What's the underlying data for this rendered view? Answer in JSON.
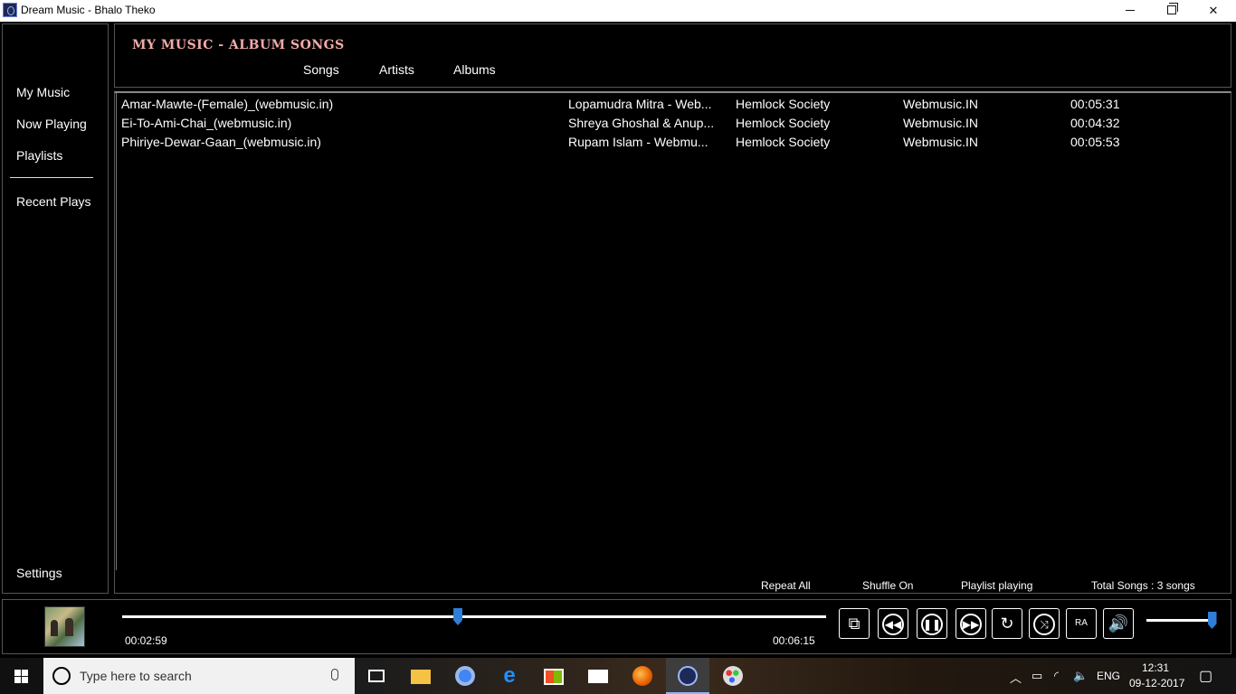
{
  "window": {
    "title": "Dream Music - Bhalo Theko"
  },
  "sidebar": {
    "items": [
      "My Music",
      "Now Playing",
      "Playlists"
    ],
    "recent": "Recent Plays",
    "settings": "Settings"
  },
  "header": {
    "title": "MY MUSIC - ALBUM SONGS",
    "tabs": [
      "Songs",
      "Artists",
      "Albums"
    ]
  },
  "songs": [
    {
      "title": "Amar-Mawte-(Female)_(webmusic.in)",
      "artist": "Lopamudra Mitra  - Web...",
      "album": "Hemlock Society",
      "genre": "Webmusic.IN",
      "duration": "00:05:31"
    },
    {
      "title": "Ei-To-Ami-Chai_(webmusic.in)",
      "artist": "Shreya Ghoshal & Anup...",
      "album": "Hemlock Society",
      "genre": "Webmusic.IN",
      "duration": "00:04:32"
    },
    {
      "title": "Phiriye-Dewar-Gaan_(webmusic.in)",
      "artist": "Rupam Islam  - Webmu...",
      "album": "Hemlock Society",
      "genre": "Webmusic.IN",
      "duration": "00:05:53"
    }
  ],
  "status": {
    "repeat": "Repeat All",
    "shuffle": "Shuffle On",
    "mode": "Playlist playing",
    "total": "Total Songs : 3 songs"
  },
  "player": {
    "elapsed": "00:02:59",
    "duration": "00:06:15",
    "progress_fraction": 0.477,
    "volume_fraction": 0.98,
    "ra_label": "RA",
    "accent_color": "#2f7fd6"
  },
  "taskbar": {
    "search_placeholder": "Type here to search",
    "language": "ENG",
    "time": "12:31",
    "date": "09-12-2017"
  }
}
